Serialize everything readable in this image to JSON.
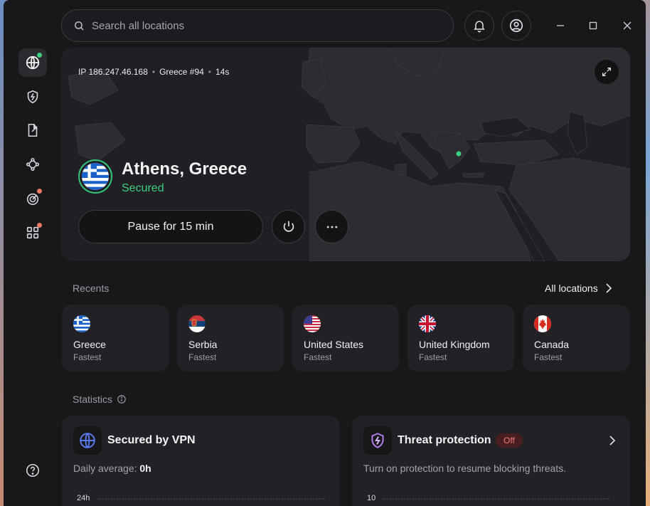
{
  "search": {
    "placeholder": "Search all locations"
  },
  "connection": {
    "ip": "IP 186.247.46.168",
    "server": "Greece #94",
    "duration": "14s",
    "location": "Athens, Greece",
    "status": "Secured",
    "pause_label": "Pause for 15 min"
  },
  "recents": {
    "title": "Recents",
    "all_label": "All locations",
    "items": [
      {
        "country": "Greece",
        "mode": "Fastest",
        "flag": "greece-flag"
      },
      {
        "country": "Serbia",
        "mode": "Fastest",
        "flag": "serbia-flag"
      },
      {
        "country": "United States",
        "mode": "Fastest",
        "flag": "us-flag"
      },
      {
        "country": "United Kingdom",
        "mode": "Fastest",
        "flag": "uk-flag"
      },
      {
        "country": "Canada",
        "mode": "Fastest",
        "flag": "canada-flag"
      }
    ]
  },
  "statistics": {
    "title": "Statistics",
    "vpn": {
      "title": "Secured by VPN",
      "avg_label": "Daily average: ",
      "avg_value": "0h",
      "axis_top": "24h"
    },
    "threat": {
      "title": "Threat protection",
      "badge": "Off",
      "desc": "Turn on protection to resume blocking threats.",
      "axis_top": "10"
    }
  },
  "colors": {
    "accent_green": "#3ecf7f",
    "badge_red": "#f07a78",
    "background": "#18181b"
  }
}
